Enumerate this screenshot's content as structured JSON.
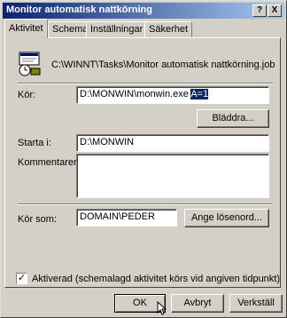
{
  "window": {
    "title": "Monitor automatisk nattkörning"
  },
  "title_buttons": {
    "help": "?",
    "close": "X"
  },
  "tabs": [
    {
      "label": "Aktivitet"
    },
    {
      "label": "Schema"
    },
    {
      "label": "Inställningar"
    },
    {
      "label": "Säkerhet"
    }
  ],
  "task": {
    "path": "C:\\WINNT\\Tasks\\Monitor automatisk nattkörning.job"
  },
  "run": {
    "label": "Kör:",
    "value_plain": "D:\\MONWIN\\monwin.exe ",
    "value_selected": "A=1",
    "browse_button": "Bläddra..."
  },
  "start_in": {
    "label": "Starta i:",
    "value": "D:\\MONWIN"
  },
  "comments": {
    "label": "Kommentarer:",
    "value": ""
  },
  "run_as": {
    "label": "Kör som:",
    "value": "DOMAIN\\PEDER",
    "password_button": "Ange lösenord..."
  },
  "enabled": {
    "label": "Aktiverad (schemalagd aktivitet körs vid angiven tidpunkt)",
    "checked": true,
    "mark": "✓"
  },
  "footer": {
    "ok": "OK",
    "cancel": "Avbryt",
    "apply": "Verkställ"
  }
}
